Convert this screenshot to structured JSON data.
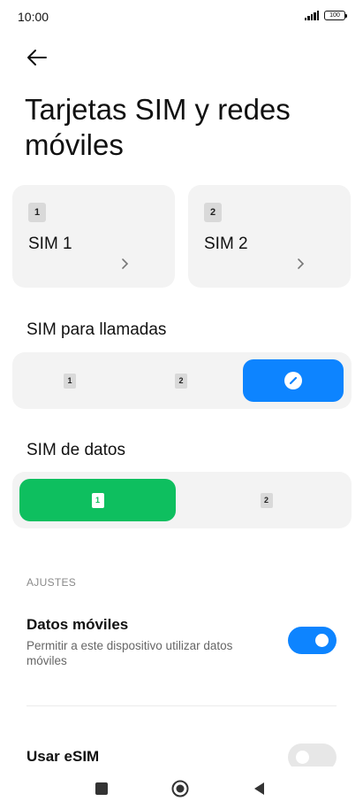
{
  "status_bar": {
    "time": "10:00",
    "battery": "100",
    "signal_icon": "signal-icon",
    "battery_icon": "battery-icon"
  },
  "header": {
    "back_icon": "arrow-left-icon",
    "title": "Tarjetas SIM y redes móviles"
  },
  "sim_cards": [
    {
      "badge": "1",
      "name": "SIM 1",
      "icon": "chevron-right-icon"
    },
    {
      "badge": "2",
      "name": "SIM 2",
      "icon": "chevron-right-icon"
    }
  ],
  "calls": {
    "heading": "SIM para llamadas",
    "options": [
      {
        "badge": "1",
        "selected": false
      },
      {
        "badge": "2",
        "selected": false
      },
      {
        "icon": "pencil-icon",
        "selected": true
      }
    ],
    "accent": "#0d84ff"
  },
  "data_sim": {
    "heading": "SIM de datos",
    "options": [
      {
        "badge": "1",
        "selected": true
      },
      {
        "badge": "2",
        "selected": false
      }
    ],
    "accent": "#0ebf5f"
  },
  "settings": {
    "section_label": "AJUSTES",
    "mobile_data": {
      "title": "Datos móviles",
      "description": "Permitir a este dispositivo utilizar datos móviles",
      "enabled": true
    },
    "esim": {
      "title": "Usar eSIM",
      "enabled": false
    }
  },
  "nav_bar": {
    "recents_icon": "square-icon",
    "home_icon": "circle-home-icon",
    "back_icon": "triangle-back-icon"
  }
}
